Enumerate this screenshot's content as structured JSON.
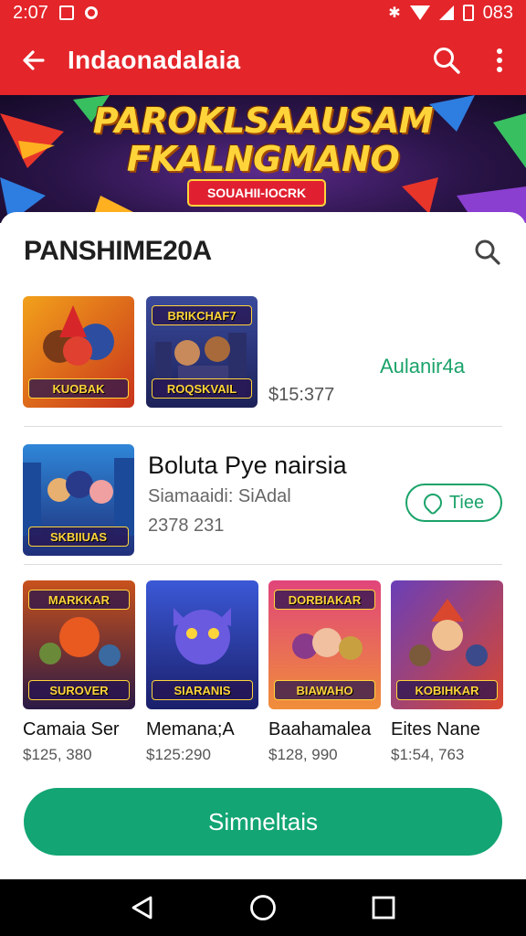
{
  "status_bar": {
    "time": "2:07",
    "battery": "083"
  },
  "app_bar": {
    "title": "Indaonadalaia"
  },
  "banner": {
    "headline_line1": "PAROKLSAAUSAM",
    "headline_line2": "FKALNGMANO",
    "tag": "SOUAHII-IOCRK"
  },
  "sheet": {
    "title": "PANSHIME20A",
    "row1": {
      "thumbs": [
        {
          "label": "KUOBAK",
          "colors": [
            "#f2a11b",
            "#c9341b"
          ]
        },
        {
          "label": "ROQSKVAIL",
          "top_label": "BRIKCHAF7",
          "colors": [
            "#3a4a9c",
            "#1c2158"
          ]
        }
      ],
      "price": "$15:377",
      "accent": "Aulanir4a"
    },
    "row2": {
      "thumb": {
        "label": "SKBIIUAS",
        "colors": [
          "#2f86d8",
          "#1f2f7a"
        ]
      },
      "title": "Boluta Pye nairsia",
      "subtitle": "Siamaaidi: SiAdal",
      "number": "2378 231",
      "tag_button": "Tiee"
    },
    "cards": [
      {
        "name": "Camaia Ser",
        "price": "$125, 380",
        "label": "SUROVER",
        "top_label": "MARKKAR",
        "colors": [
          "#c8511c",
          "#2a1a46"
        ]
      },
      {
        "name": "Memana;A",
        "price": "$125:290",
        "label": "SIARANIS",
        "colors": [
          "#3b58d6",
          "#1a1f6a"
        ]
      },
      {
        "name": "Baahamalea",
        "price": "$128, 990",
        "label": "BIAWAHO",
        "top_label": "DORBIAKAR",
        "colors": [
          "#e0457a",
          "#f08e3a"
        ]
      },
      {
        "name": "Eites Nane",
        "price": "$1:54, 763",
        "label": "KOBIHKAR",
        "colors": [
          "#6a3fb8",
          "#d9472f"
        ]
      }
    ],
    "cta_label": "Simneltais"
  },
  "colors": {
    "brand_red": "#e4252a",
    "accent_green": "#13a574",
    "text_green": "#1ba36a"
  }
}
